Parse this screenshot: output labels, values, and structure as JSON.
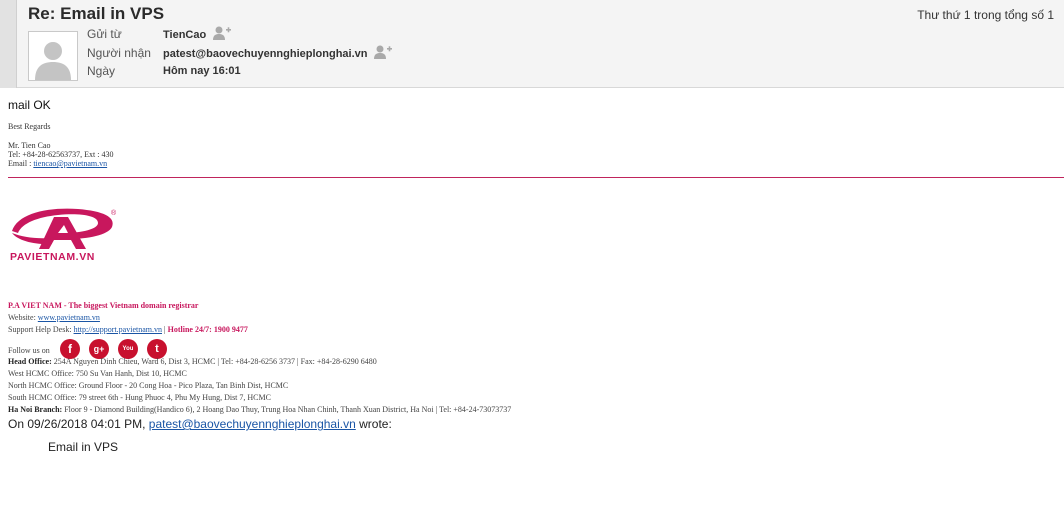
{
  "header": {
    "subject": "Re: Email in VPS",
    "counter": "Thư thứ 1 trong tổng số 1",
    "from_label": "Gửi từ",
    "from_value": "TienCao",
    "to_label": "Người nhận",
    "to_value": "patest@baovechuyennghieplonghai.vn",
    "date_label": "Ngày",
    "date_value": "Hôm nay 16:01"
  },
  "body": {
    "greeting": "mail OK",
    "regards": "Best Regards",
    "signature_name": "Mr. Tien Cao",
    "signature_tel": "Tel: +84-28-62563737, Ext : 430",
    "signature_email_label": "Email : ",
    "signature_email": "tiencao@pavietnam.vn",
    "logo_text": "PAVIETNAM.VN",
    "logo_reg": "®",
    "company_tagline": "P.A VIET NAM - The biggest Vietnam domain registrar",
    "website_label": "Website: ",
    "website_link": "www.pavietnam.vn",
    "support_label": "Support Help Desk: ",
    "support_link": "http://support.pavietnam.vn",
    "support_sep": " | ",
    "hotline": "Hotline 24/7: 1900 9477",
    "follow_label": "Follow us on",
    "social": [
      {
        "name": "facebook",
        "glyph": "f"
      },
      {
        "name": "google-plus",
        "glyph": "g+"
      },
      {
        "name": "youtube",
        "glyph": "You"
      },
      {
        "name": "twitter",
        "glyph": "t"
      }
    ],
    "head_office_label": "Head Office:",
    "head_office": " 254A Nguyen Dinh Chieu, Ward 6, Dist 3, HCMC | Tel: +84-28-6256 3737 | Fax: +84-28-6290 6480",
    "west_office": "West HCMC Office: 750 Su Van Hanh, Dist 10, HCMC",
    "north_office": "North HCMC Office: Ground Floor - 20 Cong Hoa - Pico Plaza, Tan Binh Dist, HCMC",
    "south_office": "South HCMC Office: 79 street 6th - Hung Phuoc 4, Phu My Hung, Dist 7, HCMC",
    "hanoi_label": "Ha Noi Branch:",
    "hanoi_office": " Floor 9 - Diamond Building(Handico 6), 2 Hoang Dao Thuy, Trung Hoa Nhan Chinh, Thanh Xuan District, Ha Noi | Tel: +84-24-73073737",
    "quote_prefix": "On 09/26/2018 04:01 PM, ",
    "quote_email": "patest@baovechuyennghieplonghai.vn",
    "quote_suffix": " wrote:",
    "quoted_text": "Email in VPS"
  },
  "colors": {
    "brand": "#c8175d",
    "link": "#1a55a5",
    "social": "#c8102e"
  }
}
